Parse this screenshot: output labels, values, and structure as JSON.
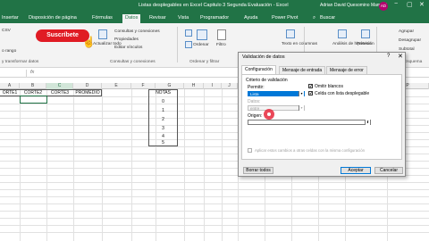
{
  "window": {
    "title": "Listas desplegables en Excel Capitulo 3 Segunda Evaluación - Excel",
    "user": "Adrian David Quesomino Mamani",
    "avatar": "AD",
    "minimize": "−",
    "maximize": "▢",
    "close": "✕"
  },
  "menu": {
    "tabs": [
      "Insertar",
      "Disposición de página",
      "Fórmulas",
      "Datos",
      "Revisar",
      "Vista",
      "Programador",
      "Ayuda",
      "Power Pivot"
    ],
    "active": "Datos",
    "search_placeholder": "Buscar"
  },
  "ribbon": {
    "subscribe": "Suscríbete",
    "get_data_partial": "CSV",
    "web_partial": "o rango",
    "refresh_label": "Actualizar todo",
    "queries": [
      "Consultas y conexiones",
      "Propiedades",
      "Editar vínculos"
    ],
    "group_get": "y transformar datos",
    "group_queries": "Consultas y conexiones",
    "group_sort": "Ordenar y filtrar",
    "sort_label": "Ordenar",
    "filter_label": "Filtro",
    "text_columns": "Texto en columnas",
    "analysis": "Análisis de hipótesis",
    "forecast": "Previsión",
    "group_forecast": "Previsión",
    "outline": [
      "Agrupar",
      "Desagrupar",
      "Subtotal"
    ],
    "group_outline": "Esquema"
  },
  "formula_bar": {
    "fx": "fx"
  },
  "columns": {
    "headers": [
      "A",
      "B",
      "C",
      "D",
      "E",
      "F",
      "G",
      "H",
      "I",
      "J",
      "K",
      "L",
      "M",
      "N",
      "O",
      "P"
    ]
  },
  "sheet": {
    "table_headers": [
      "ORTE1",
      "CORTE2",
      "CORTE3",
      "PROMEDIO"
    ],
    "notas_header": "NOTAS",
    "notas": [
      "0",
      "1",
      "2",
      "3",
      "4",
      "5"
    ]
  },
  "dialog": {
    "title": "Validación de datos",
    "help": "?",
    "close": "✕",
    "tabs": [
      "Configuración",
      "Mensaje de entrada",
      "Mensaje de error"
    ],
    "section": "Criterio de validación",
    "permitir_label": "Permitir:",
    "permitir_value": "Lista",
    "omit_blanks": "Omitir blancos",
    "celda_dropdown": "Celda con lista desplegable",
    "datos_label": "Datos:",
    "datos_value": "entre",
    "origen_label": "Origen:",
    "apply_all": "Aplicar estos cambios a otras celdas con la misma configuración",
    "btn_clear": "Borrar todos",
    "btn_ok": "Aceptar",
    "btn_cancel": "Cancelar",
    "check_mark": "✔",
    "arrow": "▾",
    "range_icon": "⬆"
  }
}
